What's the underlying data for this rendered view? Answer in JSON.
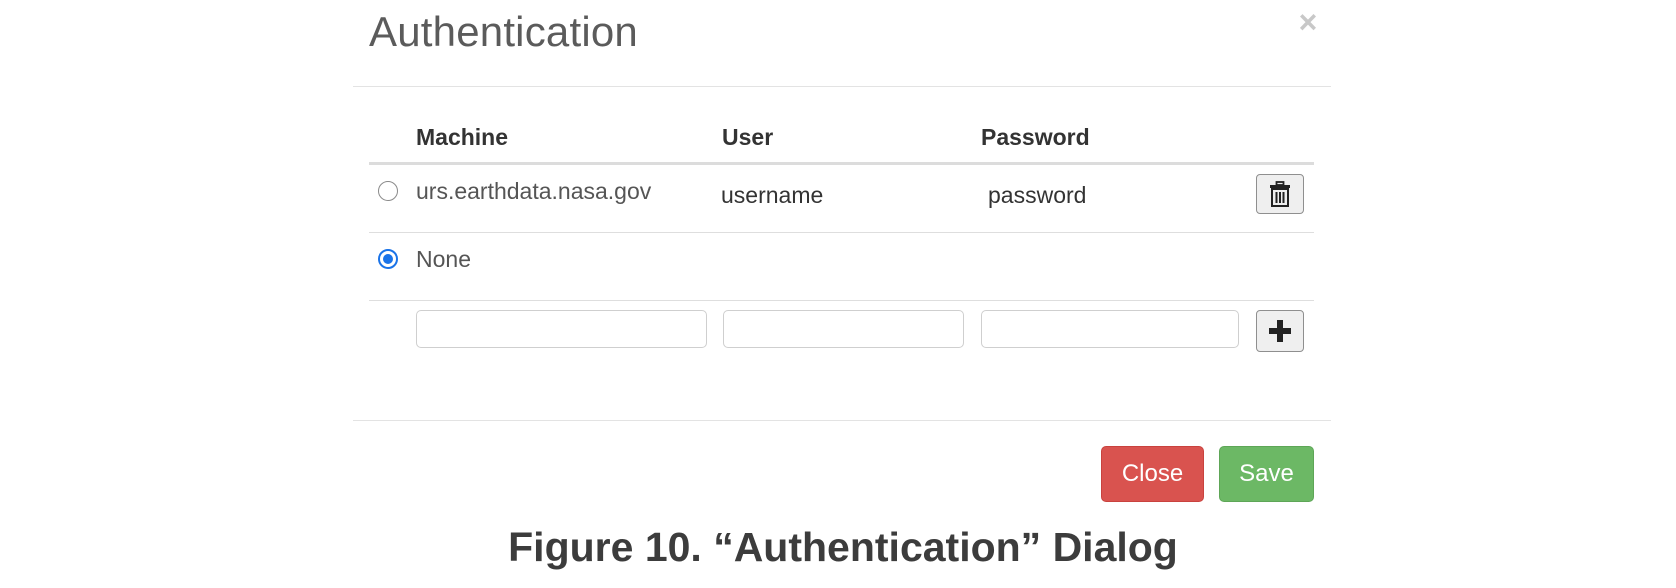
{
  "dialog": {
    "title": "Authentication",
    "close_glyph": "×"
  },
  "table": {
    "headers": [
      "Machine",
      "User",
      "Password"
    ],
    "rows": [
      {
        "machine": "urs.earthdata.nasa.gov",
        "user": "username",
        "password": "password",
        "selected": false,
        "action_icon": "trash-icon"
      },
      {
        "machine": "None",
        "selected": true
      }
    ],
    "new_entry": {
      "machine_value": "",
      "user_value": "",
      "password_value": "",
      "add_icon": "plus-icon"
    }
  },
  "footer": {
    "close_label": "Close",
    "save_label": "Save"
  },
  "caption": "Figure 10. “Authentication” Dialog",
  "colors": {
    "close_button": "#d9534f",
    "save_button": "#6cb865",
    "radio_selected": "#1a73e8"
  }
}
